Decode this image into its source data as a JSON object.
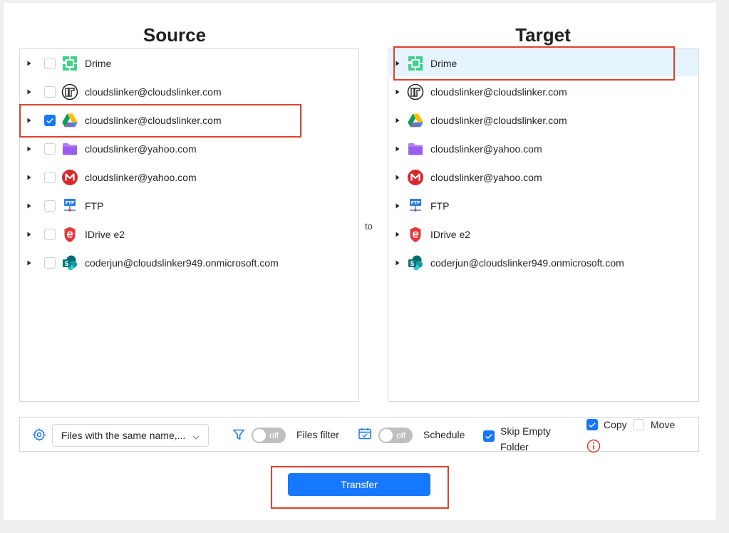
{
  "source": {
    "title": "Source",
    "items": [
      {
        "label": "Drime",
        "icon": "drime-icon",
        "checked": false
      },
      {
        "label": "cloudslinker@cloudslinker.com",
        "icon": "fichier-icon",
        "checked": false
      },
      {
        "label": "cloudslinker@cloudslinker.com",
        "icon": "google-drive-icon",
        "checked": true
      },
      {
        "label": "cloudslinker@yahoo.com",
        "icon": "yahoo-folder-icon",
        "checked": false
      },
      {
        "label": "cloudslinker@yahoo.com",
        "icon": "mega-icon",
        "checked": false
      },
      {
        "label": "FTP",
        "icon": "ftp-icon",
        "checked": false
      },
      {
        "label": "IDrive e2",
        "icon": "idrive-e2-icon",
        "checked": false
      },
      {
        "label": "coderjun@cloudslinker949.onmicrosoft.com",
        "icon": "sharepoint-icon",
        "checked": false
      }
    ]
  },
  "connector": {
    "label": "to"
  },
  "target": {
    "title": "Target",
    "selected_index": 0,
    "items": [
      {
        "label": "Drime",
        "icon": "drime-icon"
      },
      {
        "label": "cloudslinker@cloudslinker.com",
        "icon": "fichier-icon"
      },
      {
        "label": "cloudslinker@cloudslinker.com",
        "icon": "google-drive-icon"
      },
      {
        "label": "cloudslinker@yahoo.com",
        "icon": "yahoo-folder-icon"
      },
      {
        "label": "cloudslinker@yahoo.com",
        "icon": "mega-icon"
      },
      {
        "label": "FTP",
        "icon": "ftp-icon"
      },
      {
        "label": "IDrive e2",
        "icon": "idrive-e2-icon"
      },
      {
        "label": "coderjun@cloudslinker949.onmicrosoft.com",
        "icon": "sharepoint-icon"
      }
    ]
  },
  "options": {
    "conflict_select": "Files with the same name,...",
    "files_filter": {
      "state": "off",
      "label": "Files filter"
    },
    "schedule": {
      "state": "off",
      "label": "Schedule"
    },
    "skip_empty": {
      "checked": true,
      "label_line1": "Skip Empty",
      "label_line2": "Folder"
    },
    "copy": {
      "checked": true,
      "label": "Copy"
    },
    "move": {
      "checked": false,
      "label": "Move"
    }
  },
  "transfer_button": "Transfer",
  "colors": {
    "accent": "#1677ff",
    "highlight_box": "#e0412c",
    "selected_row": "#e6f4ff"
  }
}
